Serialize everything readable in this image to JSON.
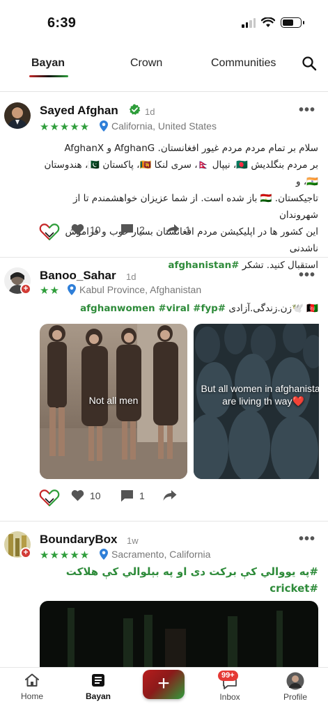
{
  "status": {
    "time": "6:39"
  },
  "tabs": [
    {
      "label": "Bayan",
      "active": true
    },
    {
      "label": "Crown",
      "active": false
    },
    {
      "label": "Communities",
      "active": false
    }
  ],
  "colors": {
    "accent_green": "#2e9d3a",
    "accent_red": "#c62828",
    "badge_red": "#e53935"
  },
  "posts": [
    {
      "username": "Sayed Afghan",
      "verified": true,
      "time": "1d",
      "stars": "★★★★★",
      "location": "California, United States",
      "body_lines": [
        "سلام بر تمام مردم مردم غیور افغانستان. AfghanG و AfghanX",
        "بر مردم بنگلدیش 🇧🇩، نیپال 🇳🇵، سری لنکا 🇱🇰، پاکستان 🇵🇰، هندوستان 🇮🇳، و",
        "تاجیکستان. 🇹🇯 باز شده است. از شما عزیزان خواهشمندم تا از شهروندان",
        "این کشور ها در اپلیکیشن مردم افغانستان بسیار خوب و فراموش ناشدنی",
        "استقبال کنید. تشکر"
      ],
      "hashtags": "afghanistan#",
      "likes": "10",
      "comments": "2",
      "shares": "1"
    },
    {
      "username": "Banoo_Sahar",
      "time": "1d",
      "stars": "★★",
      "location": "Kabul Province, Afghanistan",
      "body_prefix": "🇦🇫 🕊️زن.زندگی.آزادی",
      "hashtags": "afghanwomen #viral #fyp#",
      "media": [
        {
          "caption": "Not all men"
        },
        {
          "caption": "But all women in afghanistan are living th way❤️"
        }
      ],
      "likes": "10",
      "comments": "1"
    },
    {
      "username": "BoundaryBox",
      "time": "1w",
      "stars": "★★★★★",
      "location": "Sacramento, California",
      "hashtags_line1": "#په یووالي کې برکت دی او په بېلوالي کې هلاکت",
      "hashtags_line2": "cricket#"
    }
  ],
  "bottom_nav": {
    "home": "Home",
    "bayan": "Bayan",
    "create": "+",
    "inbox": "Inbox",
    "inbox_badge": "99+",
    "profile": "Profile"
  }
}
